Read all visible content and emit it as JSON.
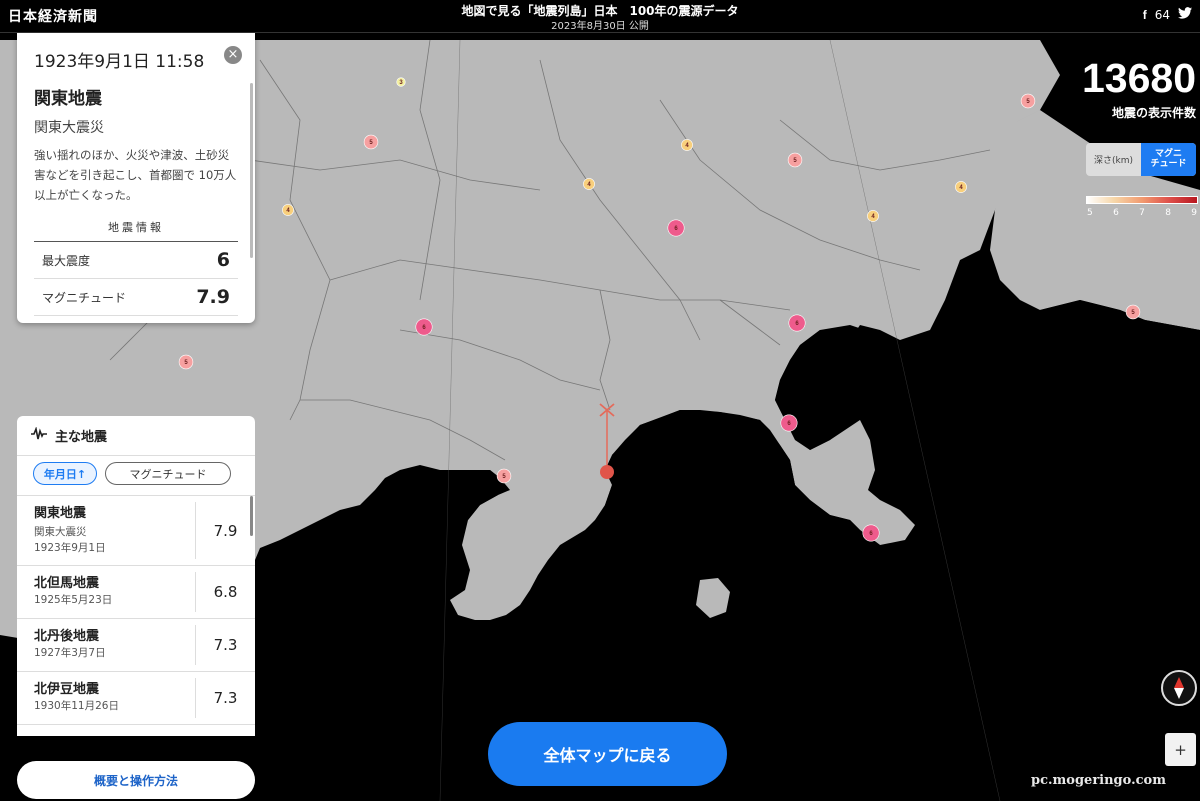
{
  "header": {
    "brand": "日本経済新聞",
    "title": "地図で見る「地震列島」日本　100年の震源データ",
    "date": "2023年8月30日 公開",
    "facebook_label": "f",
    "share_count": "64"
  },
  "detail": {
    "datetime": "1923年9月1日 11:58",
    "name": "関東地震",
    "alias": "関東大震災",
    "description": "強い揺れのほか、火災や津波、土砂災害などを引き起こし、首都圏で 10万人以上が亡くなった。",
    "section_title": "地震情報",
    "intensity_label": "最大震度",
    "intensity_value": "6",
    "magnitude_label": "マグニチュード",
    "magnitude_value": "7.9"
  },
  "stats": {
    "count": "13680",
    "count_caption": "地震の表示件数"
  },
  "toggle": {
    "depth_label": "深さ(km)",
    "magnitude_label": "マグニ\nチュード"
  },
  "legend": {
    "ticks": [
      "5",
      "6",
      "7",
      "8",
      "9"
    ]
  },
  "major_list": {
    "title": "主な地震",
    "sort_date": "年月日↑",
    "sort_magnitude": "マグニチュード",
    "items": [
      {
        "name": "関東地震",
        "alias": "関東大震災",
        "date": "1923年9月1日",
        "magnitude": "7.9"
      },
      {
        "name": "北但馬地震",
        "alias": "",
        "date": "1925年5月23日",
        "magnitude": "6.8"
      },
      {
        "name": "北丹後地震",
        "alias": "",
        "date": "1927年3月7日",
        "magnitude": "7.3"
      },
      {
        "name": "北伊豆地震",
        "alias": "",
        "date": "1930年11月26日",
        "magnitude": "7.3"
      }
    ]
  },
  "buttons": {
    "overview": "概要と操作方法",
    "back_to_map": "全体マップに戻る",
    "zoom_in": "+"
  },
  "watermark": "pc.mogeringo.com",
  "markers": [
    {
      "label": "3",
      "color": "#f3f0a0",
      "magnitude": 3
    },
    {
      "label": "5",
      "color": "#f6a0a0",
      "magnitude": 5
    },
    {
      "label": "4",
      "color": "#f8cf7c",
      "magnitude": 4
    },
    {
      "label": "4",
      "color": "#f8cf7c",
      "magnitude": 4
    },
    {
      "label": "5",
      "color": "#f6a0a0",
      "magnitude": 5
    },
    {
      "label": "4",
      "color": "#f8cf7c",
      "magnitude": 4
    },
    {
      "label": "4",
      "color": "#f8cf7c",
      "magnitude": 4
    },
    {
      "label": "4",
      "color": "#f8cf7c",
      "magnitude": 4
    },
    {
      "label": "6",
      "color": "#ee5b8c",
      "magnitude": 6
    },
    {
      "label": "6",
      "color": "#ee5b8c",
      "magnitude": 6
    },
    {
      "label": "6",
      "color": "#ee5b8c",
      "magnitude": 6
    },
    {
      "label": "5",
      "color": "#f6a0a0",
      "magnitude": 5
    },
    {
      "label": "5",
      "color": "#f6a0a0",
      "magnitude": 5
    },
    {
      "label": "6",
      "color": "#ee5b8c",
      "magnitude": 6
    },
    {
      "label": "5",
      "color": "#f6a0a0",
      "magnitude": 5
    },
    {
      "label": "6",
      "color": "#ee5b8c",
      "magnitude": 6
    },
    {
      "label": "5",
      "color": "#f6a0a0",
      "magnitude": 5
    }
  ]
}
